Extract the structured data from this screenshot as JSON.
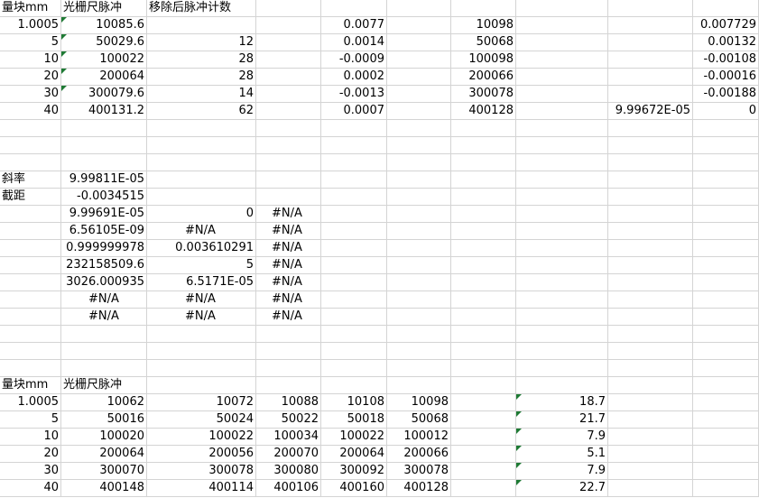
{
  "rows": [
    [
      "量块mm",
      "光栅尺脉冲",
      "移除后脉冲计数",
      "",
      "",
      "",
      "",
      "",
      "",
      ""
    ],
    [
      "1.0005",
      "10085.6",
      "",
      "",
      "0.0077",
      "",
      "10098",
      "",
      "",
      "0.007729"
    ],
    [
      "5",
      "50029.6",
      "12",
      "",
      "0.0014",
      "",
      "50068",
      "",
      "",
      "0.00132"
    ],
    [
      "10",
      "100022",
      "28",
      "",
      "-0.0009",
      "",
      "100098",
      "",
      "",
      "-0.00108"
    ],
    [
      "20",
      "200064",
      "28",
      "",
      "0.0002",
      "",
      "200066",
      "",
      "",
      "-0.00016"
    ],
    [
      "30",
      "300079.6",
      "14",
      "",
      "-0.0013",
      "",
      "300078",
      "",
      "",
      "-0.00188"
    ],
    [
      "40",
      "400131.2",
      "62",
      "",
      "0.0007",
      "",
      "400128",
      "",
      "9.99672E-05",
      "0"
    ],
    [
      "",
      "",
      "",
      "",
      "",
      "",
      "",
      "",
      "",
      ""
    ],
    [
      "",
      "",
      "",
      "",
      "",
      "",
      "",
      "",
      "",
      ""
    ],
    [
      "",
      "",
      "",
      "",
      "",
      "",
      "",
      "",
      "",
      ""
    ],
    [
      "斜率",
      "9.99811E-05",
      "",
      "",
      "",
      "",
      "",
      "",
      "",
      ""
    ],
    [
      "截距",
      "-0.0034515",
      "",
      "",
      "",
      "",
      "",
      "",
      "",
      ""
    ],
    [
      "",
      "9.99691E-05",
      "0",
      "#N/A",
      "",
      "",
      "",
      "",
      "",
      ""
    ],
    [
      "",
      "6.56105E-09",
      "#N/A",
      "#N/A",
      "",
      "",
      "",
      "",
      "",
      ""
    ],
    [
      "",
      "0.999999978",
      "0.003610291",
      "#N/A",
      "",
      "",
      "",
      "",
      "",
      ""
    ],
    [
      "",
      "232158509.6",
      "5",
      "#N/A",
      "",
      "",
      "",
      "",
      "",
      ""
    ],
    [
      "",
      "3026.000935",
      "6.5171E-05",
      "#N/A",
      "",
      "",
      "",
      "",
      "",
      ""
    ],
    [
      "",
      "#N/A",
      "#N/A",
      "#N/A",
      "",
      "",
      "",
      "",
      "",
      ""
    ],
    [
      "",
      "#N/A",
      "#N/A",
      "#N/A",
      "",
      "",
      "",
      "",
      "",
      ""
    ],
    [
      "",
      "",
      "",
      "",
      "",
      "",
      "",
      "",
      "",
      ""
    ],
    [
      "",
      "",
      "",
      "",
      "",
      "",
      "",
      "",
      "",
      ""
    ],
    [
      "",
      "",
      "",
      "",
      "",
      "",
      "",
      "",
      "",
      ""
    ],
    [
      "量块mm",
      "光栅尺脉冲",
      "",
      "",
      "",
      "",
      "",
      "",
      "",
      ""
    ],
    [
      "1.0005",
      "10062",
      "10072",
      "10088",
      "10108",
      "10098",
      "",
      "18.7",
      "",
      ""
    ],
    [
      "5",
      "50016",
      "50024",
      "50022",
      "50018",
      "50068",
      "",
      "21.7",
      "",
      ""
    ],
    [
      "10",
      "100020",
      "100022",
      "100034",
      "100022",
      "100012",
      "",
      "7.9",
      "",
      ""
    ],
    [
      "20",
      "200064",
      "200056",
      "200070",
      "200064",
      "200066",
      "",
      "5.1",
      "",
      ""
    ],
    [
      "30",
      "300070",
      "300078",
      "300080",
      "300092",
      "300078",
      "",
      "7.9",
      "",
      ""
    ],
    [
      "40",
      "400148",
      "400114",
      "400106",
      "400160",
      "400128",
      "",
      "22.7",
      "",
      ""
    ]
  ]
}
